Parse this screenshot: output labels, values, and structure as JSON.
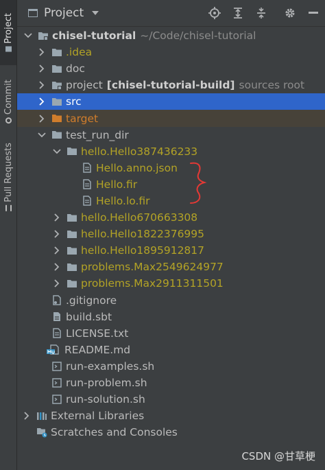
{
  "toolstrip": {
    "tabs": [
      {
        "label": "Project"
      },
      {
        "label": "Commit"
      },
      {
        "label": "Pull Requests"
      }
    ]
  },
  "header": {
    "title": "Project"
  },
  "tree": {
    "root": {
      "name": "chisel-tutorial",
      "path": "~/Code/chisel-tutorial"
    },
    "idea": ".idea",
    "doc": "doc",
    "project": {
      "name": "project",
      "module": "[chisel-tutorial-build]",
      "note": "sources root"
    },
    "src": "src",
    "target": "target",
    "test_run_dir": "test_run_dir",
    "hello_expanded": "hello.Hello387436233",
    "hello_files": [
      "Hello.anno.json",
      "Hello.fir",
      "Hello.lo.fir"
    ],
    "collapsed_dirs": [
      "hello.Hello670663308",
      "hello.Hello1822376995",
      "hello.Hello1895912817",
      "problems.Max2549624977",
      "problems.Max2911311501"
    ],
    "files": [
      ".gitignore",
      "build.sbt",
      "LICENSE.txt",
      "README.md",
      "run-examples.sh",
      "run-problem.sh",
      "run-solution.sh"
    ],
    "external_libraries": "External Libraries",
    "scratches": "Scratches and Consoles"
  },
  "watermark": "CSDN @甘草梗",
  "colors": {
    "selection": "#2f65ca",
    "excluded": "#d07d2c",
    "untracked": "#b3a326",
    "annotation": "#e53935"
  }
}
